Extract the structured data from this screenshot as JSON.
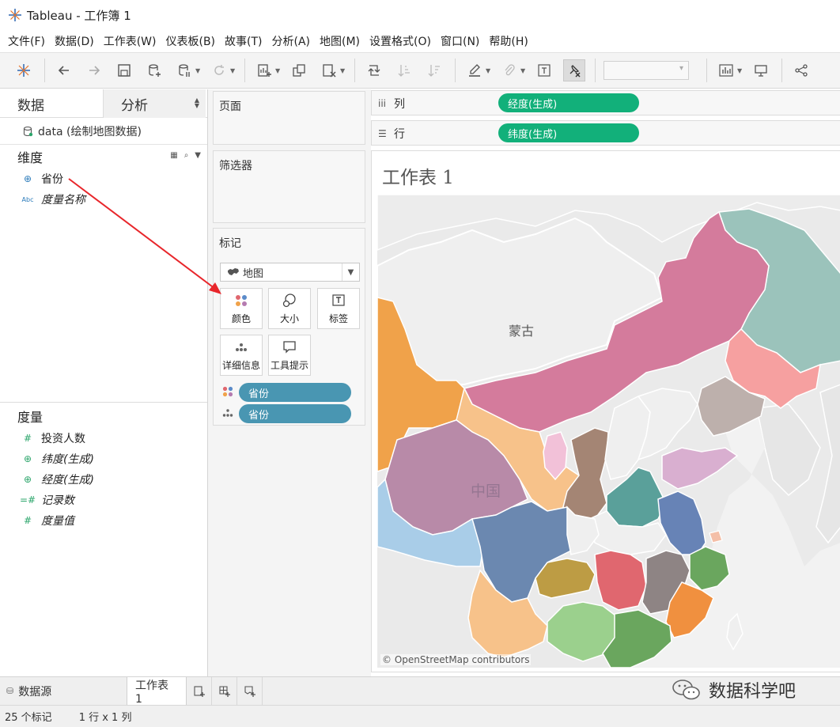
{
  "window": {
    "title": "Tableau - 工作簿 1"
  },
  "menubar": {
    "items": [
      "文件(F)",
      "数据(D)",
      "工作表(W)",
      "仪表板(B)",
      "故事(T)",
      "分析(A)",
      "地图(M)",
      "设置格式(O)",
      "窗口(N)",
      "帮助(H)"
    ]
  },
  "data_pane": {
    "tabs": [
      "数据",
      "分析"
    ],
    "datasource": "data (绘制地图数据)",
    "dimensions_title": "维度",
    "dimensions": [
      {
        "label": "省份",
        "icon": "globe-icon"
      },
      {
        "label": "度量名称",
        "icon": "abc-icon"
      }
    ],
    "measures_title": "度量",
    "measures": [
      {
        "label": "投资人数",
        "icon": "number-icon"
      },
      {
        "label": "纬度(生成)",
        "icon": "globe-icon"
      },
      {
        "label": "经度(生成)",
        "icon": "globe-icon"
      },
      {
        "label": "记录数",
        "icon": "number-icon"
      },
      {
        "label": "度量值",
        "icon": "number-icon"
      }
    ]
  },
  "cards": {
    "pages_title": "页面",
    "filters_title": "筛选器",
    "marks_title": "标记",
    "mark_type": "地图",
    "mark_buttons": [
      "颜色",
      "大小",
      "标签",
      "详细信息",
      "工具提示"
    ],
    "mark_pills": [
      "省份",
      "省份"
    ]
  },
  "shelves": {
    "columns_label": "列",
    "columns_pill": "经度(生成)",
    "rows_label": "行",
    "rows_pill": "纬度(生成)"
  },
  "view": {
    "sheet_title": "工作表 1",
    "map_labels": {
      "mongolia": "蒙古",
      "china": "中国"
    },
    "attribution": "© OpenStreetMap contributors"
  },
  "bottom_tabs": {
    "datasource": "数据源",
    "sheet": "工作表 1"
  },
  "status": {
    "marks": "25 个标记",
    "rows_cols": "1 行 x 1 列"
  },
  "watermark": "数据科学吧",
  "colors": {
    "pill_blue": "#4996b2",
    "pill_green": "#12b07a",
    "annotation_arrow": "#e8262b"
  }
}
